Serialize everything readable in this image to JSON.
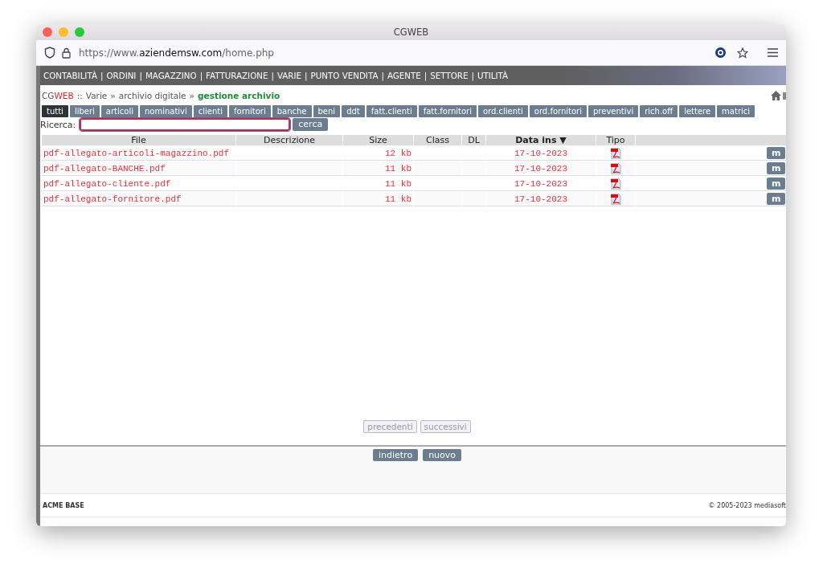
{
  "window": {
    "title": "CGWEB"
  },
  "address_bar": {
    "scheme": "https://www.",
    "domain": "aziendemsw.com",
    "path": "/home.php"
  },
  "menu": [
    "CONTABILITÀ",
    "ORDINI",
    "MAGAZZINO",
    "FATTURAZIONE",
    "VARIE",
    "PUNTO VENDITA",
    "AGENTE",
    "SETTORE",
    "UTILITÀ"
  ],
  "menu_separator": "|",
  "breadcrumb": {
    "brand_prefix": "CG",
    "brand_suffix": "WEB",
    "separator": "::",
    "path": [
      "Varie",
      "archivio digitale"
    ],
    "path_separator": "»",
    "current": "gestione archivio"
  },
  "tabs": [
    {
      "label": "tutti",
      "selected": true
    },
    {
      "label": "liberi",
      "selected": false
    },
    {
      "label": "articoli",
      "selected": false
    },
    {
      "label": "nominativi",
      "selected": false
    },
    {
      "label": "clienti",
      "selected": false
    },
    {
      "label": "fornitori",
      "selected": false
    },
    {
      "label": "banche",
      "selected": false
    },
    {
      "label": "beni",
      "selected": false
    },
    {
      "label": "ddt",
      "selected": false
    },
    {
      "label": "fatt.clienti",
      "selected": false
    },
    {
      "label": "fatt.fornitori",
      "selected": false
    },
    {
      "label": "ord.clienti",
      "selected": false
    },
    {
      "label": "ord.fornitori",
      "selected": false
    },
    {
      "label": "preventivi",
      "selected": false
    },
    {
      "label": "rich.off",
      "selected": false
    },
    {
      "label": "lettere",
      "selected": false
    },
    {
      "label": "matrici",
      "selected": false
    }
  ],
  "search": {
    "label": "Ricerca:",
    "button": "cerca"
  },
  "table": {
    "columns": [
      {
        "label": "File",
        "sorted": false
      },
      {
        "label": "Descrizione",
        "sorted": false
      },
      {
        "label": "Size",
        "sorted": false
      },
      {
        "label": "Class",
        "sorted": false
      },
      {
        "label": "DL",
        "sorted": false
      },
      {
        "label": "Data ins ▼",
        "sorted": true
      },
      {
        "label": "Tipo",
        "sorted": false
      }
    ],
    "rows": [
      {
        "file": "pdf-allegato-articoli-magazzino.pdf",
        "size": "12 kb",
        "date": "17-10-2023",
        "action": "m"
      },
      {
        "file": "pdf-allegato-BANCHE.pdf",
        "size": "11 kb",
        "date": "17-10-2023",
        "action": "m"
      },
      {
        "file": "pdf-allegato-cliente.pdf",
        "size": "11 kb",
        "date": "17-10-2023",
        "action": "m"
      },
      {
        "file": "pdf-allegato-fornitore.pdf",
        "size": "11 kb",
        "date": "17-10-2023",
        "action": "m"
      }
    ]
  },
  "pager": [
    {
      "label": "precedenti",
      "disabled": true
    },
    {
      "label": "successivi",
      "disabled": true
    }
  ],
  "actions": [
    "indietro",
    "nuovo"
  ],
  "footer": {
    "left": "ACME BASE",
    "right": "© 2005-2023 mediasoft"
  }
}
